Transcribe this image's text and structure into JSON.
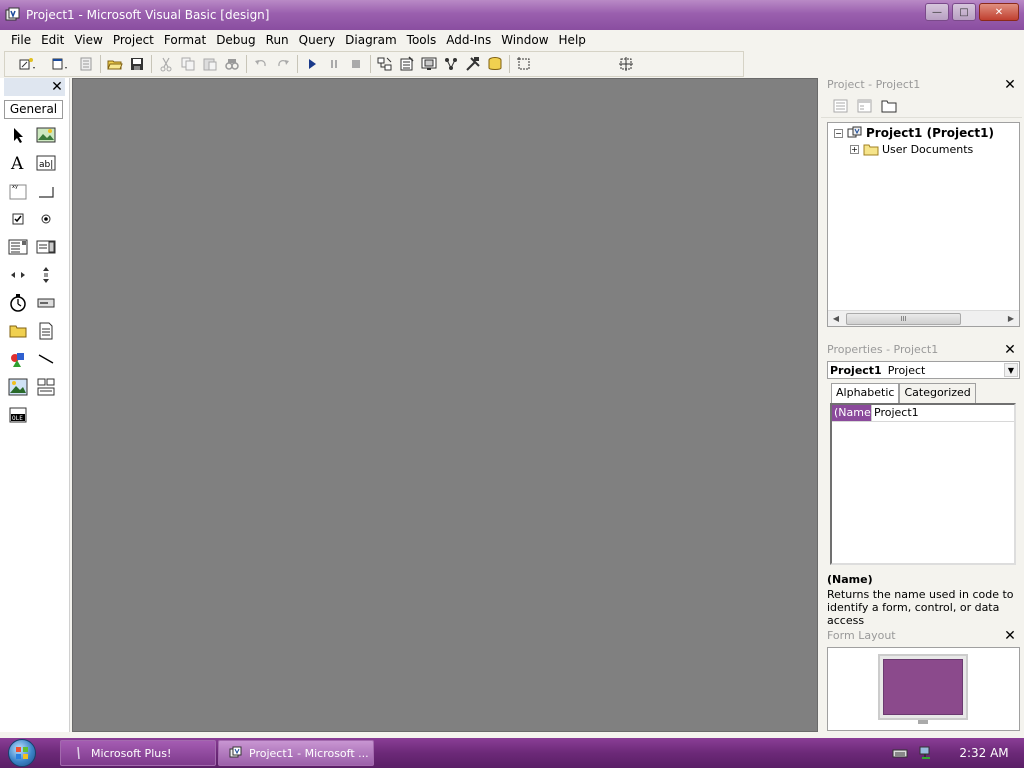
{
  "window": {
    "title": "Project1 - Microsoft Visual Basic [design]",
    "app_icon": "vb6-app-icon",
    "buttons": {
      "minimize": "—",
      "maximize": "□",
      "close": "✕"
    }
  },
  "menu": [
    {
      "label": "File",
      "icon": null
    },
    {
      "label": "Edit"
    },
    {
      "label": "View"
    },
    {
      "label": "Project"
    },
    {
      "label": "Format"
    },
    {
      "label": "Debug"
    },
    {
      "label": "Run"
    },
    {
      "label": "Query"
    },
    {
      "label": "Diagram"
    },
    {
      "label": "Tools"
    },
    {
      "label": "Add-Ins"
    },
    {
      "label": "Window"
    },
    {
      "label": "Help"
    }
  ],
  "toolbar": {
    "icons": [
      "add-project-icon",
      "add-form-icon",
      "menu-editor-icon",
      "open-project-icon",
      "save-project-icon",
      "cut-icon",
      "copy-icon",
      "paste-icon",
      "find-icon",
      "undo-icon",
      "redo-icon",
      "start-icon",
      "break-icon",
      "end-icon",
      "project-explorer-icon",
      "properties-window-icon",
      "form-layout-icon",
      "object-browser-icon",
      "toolbox-icon",
      "data-view-icon",
      "component-manager-icon",
      "position-size-icon"
    ]
  },
  "toolbox": {
    "tab_label": "General",
    "tools": [
      "pointer-icon",
      "picturebox-icon",
      "label-icon",
      "textbox-icon",
      "frame-icon",
      "commandbutton-icon",
      "checkbox-icon",
      "optionbutton-icon",
      "combobox-icon",
      "listbox-icon",
      "hscrollbar-icon",
      "vscrollbar-icon",
      "timer-icon",
      "drivelistbox-icon",
      "dirlistbox-icon",
      "filelistbox-icon",
      "shape-icon",
      "line-icon",
      "image-icon",
      "data-icon",
      "ole-icon"
    ]
  },
  "project_explorer": {
    "title": "Project - Project1",
    "root_label": "Project1 (Project1)",
    "child_label": "User Documents",
    "expander_root": "−",
    "expander_child": "+",
    "scroll_thumb_label": "III"
  },
  "properties": {
    "title": "Properties - Project1",
    "object_name": "Project1",
    "object_type": "Project",
    "tabs": [
      "Alphabetic",
      "Categorized"
    ],
    "active_tab": "Alphabetic",
    "rows": [
      {
        "key": "(Name)",
        "value": "Project1"
      }
    ],
    "description_title": "(Name)",
    "description_text": "Returns the name used in code to identify a form, control, or data access"
  },
  "form_layout": {
    "title": "Form Layout"
  },
  "taskbar": {
    "items": [
      {
        "label": "Microsoft Plus!",
        "active": false
      },
      {
        "label": "Project1 - Microsoft ...",
        "active": true
      }
    ],
    "clock": "2:32 AM"
  },
  "colors": {
    "titlebar": "#9a5fae",
    "workspace": "#808080",
    "taskbar": "#6c2978",
    "selection": "#8b4a9c"
  }
}
